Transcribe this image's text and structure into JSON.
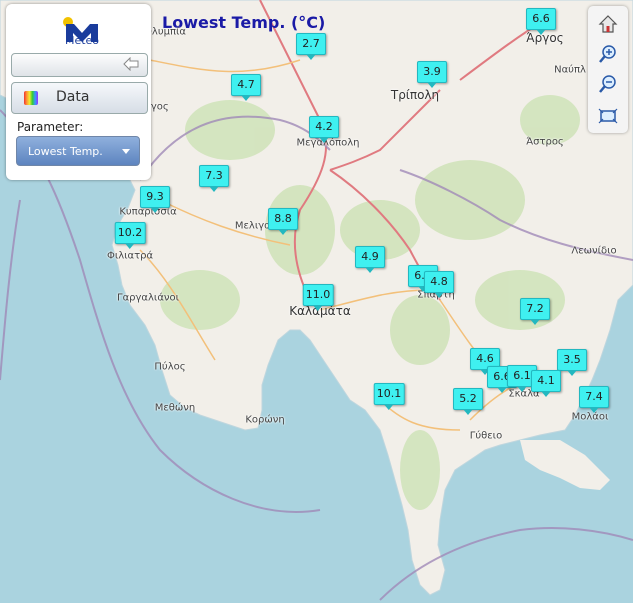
{
  "title": "Lowest Temp. (°C)",
  "panel": {
    "logo_text": "Meteo",
    "data_label": "Data",
    "parameter_label": "Parameter:",
    "parameter_value": "Lowest Temp."
  },
  "colors": {
    "marker_fill": "#3ff0f0",
    "land": "#f2efe9",
    "sea": "#aad3df",
    "title": "#1a1aa6"
  },
  "map": {
    "places": [
      {
        "name": "Ολυμπία"
      },
      {
        "name": "Άργος"
      },
      {
        "name": "Ναύπλ"
      },
      {
        "name": "Τρίπολη"
      },
      {
        "name": "Πύργος"
      },
      {
        "name": "Μεγαλόπολη"
      },
      {
        "name": "Άστρος"
      },
      {
        "name": "Κυπαρισσία"
      },
      {
        "name": "Μελιγαλάς"
      },
      {
        "name": "Φιλιατρά"
      },
      {
        "name": "Λεωνίδιο"
      },
      {
        "name": "Σπάρτη"
      },
      {
        "name": "Γαργαλιάνοι"
      },
      {
        "name": "Καλαμάτα"
      },
      {
        "name": "Πύλος"
      },
      {
        "name": "Σκάλα"
      },
      {
        "name": "Μεθώνη"
      },
      {
        "name": "Μολάοι"
      },
      {
        "name": "Κορώνη"
      },
      {
        "name": "Γύθειο"
      }
    ],
    "stations": [
      {
        "value": "2.7"
      },
      {
        "value": "6.6"
      },
      {
        "value": "3.9"
      },
      {
        "value": "4.7"
      },
      {
        "value": "4.2"
      },
      {
        "value": "7.3"
      },
      {
        "value": "9.3"
      },
      {
        "value": "8.8"
      },
      {
        "value": "10.2"
      },
      {
        "value": "4.9"
      },
      {
        "value": "6.8"
      },
      {
        "value": "4.8"
      },
      {
        "value": "11.0"
      },
      {
        "value": "7.2"
      },
      {
        "value": "4.6"
      },
      {
        "value": "3.5"
      },
      {
        "value": "6.6"
      },
      {
        "value": "6.1"
      },
      {
        "value": "4.1"
      },
      {
        "value": "10.1"
      },
      {
        "value": "5.2"
      },
      {
        "value": "7.4"
      }
    ]
  }
}
